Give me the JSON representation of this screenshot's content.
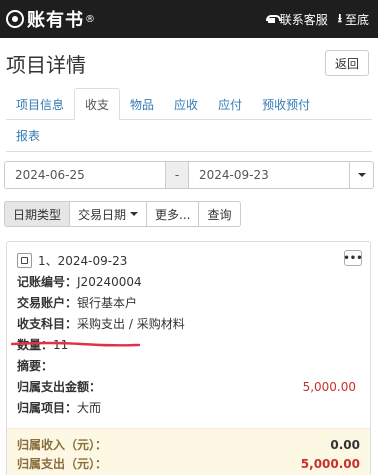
{
  "app": {
    "brand": "账有书",
    "reg": "®",
    "service": "联系客服",
    "bottom": "至底"
  },
  "page": {
    "title": "项目详情",
    "back": "返回"
  },
  "tabs": {
    "row1": [
      "项目信息",
      "收支",
      "物品",
      "应收",
      "应付",
      "预收预付"
    ],
    "row2": [
      "报表"
    ],
    "active": "收支"
  },
  "dates": {
    "start": "2024-06-25",
    "sep": "-",
    "end": "2024-09-23"
  },
  "filters": {
    "type": "日期类型",
    "trade": "交易日期",
    "more": "更多...",
    "query": "查询"
  },
  "record": {
    "header": "1、2024-09-23",
    "more": "•••",
    "fields": [
      {
        "label": "记账编号：",
        "value": "J20240004"
      },
      {
        "label": "交易账户：",
        "value": "银行基本户"
      },
      {
        "label": "收支科目：",
        "value": "采购支出 / 采购材料"
      },
      {
        "label": "数量：",
        "value": "11"
      },
      {
        "label": "摘要：",
        "value": ""
      },
      {
        "label": "归属支出金额：",
        "value": "",
        "amount": "5,000.00"
      },
      {
        "label": "归属项目：",
        "value": "大而"
      }
    ]
  },
  "summary": {
    "income_label": "归属收入（元）：",
    "income": "0.00",
    "expense_label": "归属支出（元）：",
    "expense": "5,000.00"
  },
  "colors": {
    "topbar": "#1e1e1e",
    "link": "#337ab7",
    "amount": "#c9302c",
    "summary_bg": "#fcf8e3",
    "annotation": "#e0304a"
  }
}
